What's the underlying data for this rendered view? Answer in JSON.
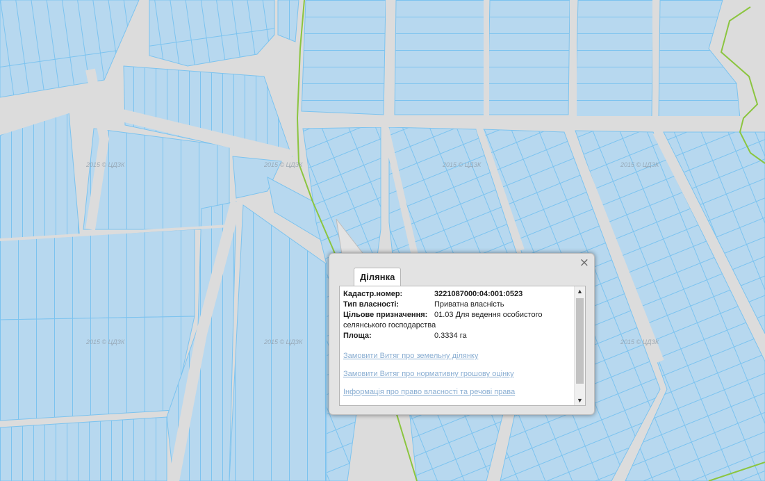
{
  "map": {
    "watermark": "2015 © ЦДЗК",
    "colors": {
      "background": "#dcdcdc",
      "parcel_fill": "#b7d8ef",
      "parcel_stroke": "#7cc3ef",
      "boundary_line": "#8bc53f"
    }
  },
  "popup": {
    "tab_label": "Ділянка",
    "close_glyph": "×",
    "fields": [
      {
        "label": "Кадастр.номер:",
        "value": "3221087000:04:001:0523"
      },
      {
        "label": "Тип власності:",
        "value": "Приватна власність"
      },
      {
        "label": "Цільове призначення:",
        "value": "01.03 Для ведення особистого селянського господарства"
      },
      {
        "label": "Площа:",
        "value": "0.3334 га"
      }
    ],
    "links": [
      "Замовити Витяг про земельну ділянку",
      "Замовити Витяг про нормативну грошову оцінку",
      "Інформація про право власності та речові права"
    ]
  }
}
